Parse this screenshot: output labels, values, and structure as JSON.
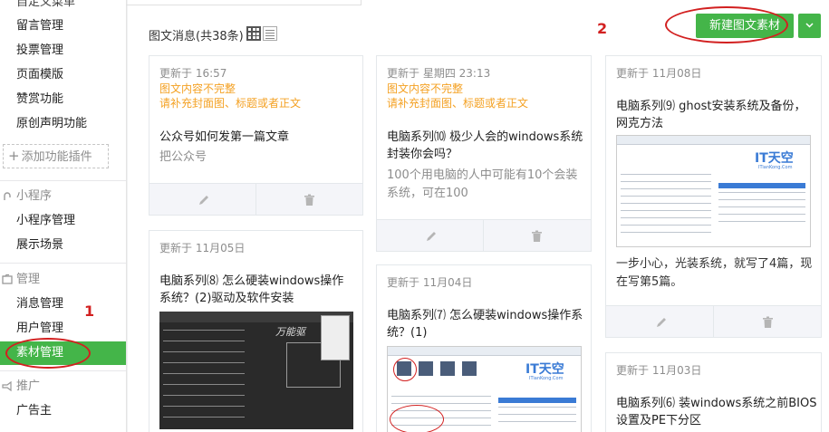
{
  "sidebar": {
    "partial_top": "自定义菜单",
    "items_a": [
      "留言管理",
      "投票管理",
      "页面模版",
      "赞赏功能",
      "原创声明功能"
    ],
    "add_plugin": "添加功能插件",
    "section_mini": "小程序",
    "items_mini": [
      "小程序管理",
      "展示场景"
    ],
    "section_manage": "管理",
    "items_manage": [
      "消息管理",
      "用户管理",
      "素材管理"
    ],
    "active": "素材管理",
    "section_promo": "推广",
    "items_promo": [
      "广告主"
    ]
  },
  "main": {
    "list_title": "图文消息(共38条)",
    "new_button": "新建图文素材",
    "view_modes": [
      "grid-icon",
      "list-icon"
    ]
  },
  "cards": [
    {
      "updated": "更新于 16:57",
      "warn1": "图文内容不完整",
      "warn2": "请补充封面图、标题或者正文",
      "title": "公众号如何发第一篇文章",
      "desc": "把公众号"
    },
    {
      "updated": "更新于 星期四 23:13",
      "warn1": "图文内容不完整",
      "warn2": "请补充封面图、标题或者正文",
      "title": "电脑系列⑽ 极少人会的windows系统封装你会吗？",
      "desc": "100个用电脑的人中可能有10个会装系统，可在100"
    },
    {
      "updated": "更新于 11月08日",
      "title": "电脑系列⑼ ghost安装系统及备份，网克方法",
      "desc": "一步小心，光装系统，就写了4篇，现在写第5篇。"
    },
    {
      "updated": "更新于 11月05日",
      "title": "电脑系列⑻ 怎么硬装windows操作系统？(2)驱动及软件安装"
    },
    {
      "updated": "更新于 11月04日",
      "title": "电脑系列⑺ 怎么硬装windows操作系统？(1)"
    },
    {
      "updated": "更新于 11月03日",
      "title": "电脑系列⑹ 装windows系统之前BIOS设置及PE下分区"
    }
  ],
  "thumb_logo": "IT天空",
  "thumb_logo_sub": "ITianKong.Com",
  "thumb_dark_text": "万能驱",
  "annotations": [
    "1",
    "2"
  ],
  "colors": {
    "accent": "#44b549",
    "warn": "#f4a123",
    "annotation": "#d22020"
  }
}
